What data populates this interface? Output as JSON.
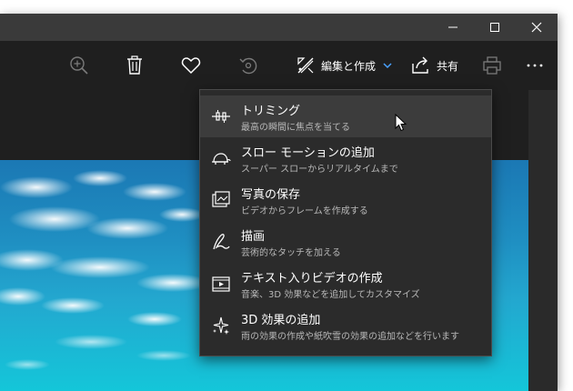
{
  "window": {
    "buttons": [
      "minimize",
      "maximize",
      "close"
    ]
  },
  "toolbar": {
    "edit_label": "編集と作成",
    "share_label": "共有",
    "icons": [
      "zoom-icon",
      "delete-icon",
      "favorite-icon",
      "rotate-icon",
      "edit-create-icon",
      "share-icon",
      "print-icon",
      "more-icon"
    ]
  },
  "menu": {
    "items": [
      {
        "title": "トリミング",
        "subtitle": "最高の瞬間に焦点を当てる",
        "icon": "trim-icon"
      },
      {
        "title": "スロー モーションの追加",
        "subtitle": "スーパー スローからリアルタイムまで",
        "icon": "turtle-icon"
      },
      {
        "title": "写真の保存",
        "subtitle": "ビデオからフレームを作成する",
        "icon": "save-frame-icon"
      },
      {
        "title": "描画",
        "subtitle": "芸術的なタッチを加える",
        "icon": "draw-icon"
      },
      {
        "title": "テキスト入りビデオの作成",
        "subtitle": "音楽、3D 効果などを追加してカスタマイズ",
        "icon": "video-text-icon"
      },
      {
        "title": "3D 効果の追加",
        "subtitle": "雨の効果の作成や紙吹雪の効果の追加などを行います",
        "icon": "sparkle-3d-icon"
      }
    ]
  },
  "colors": {
    "background": "#1f1f1f",
    "menu_bg": "#2b2b2b",
    "accent": "#4aa3ff"
  }
}
